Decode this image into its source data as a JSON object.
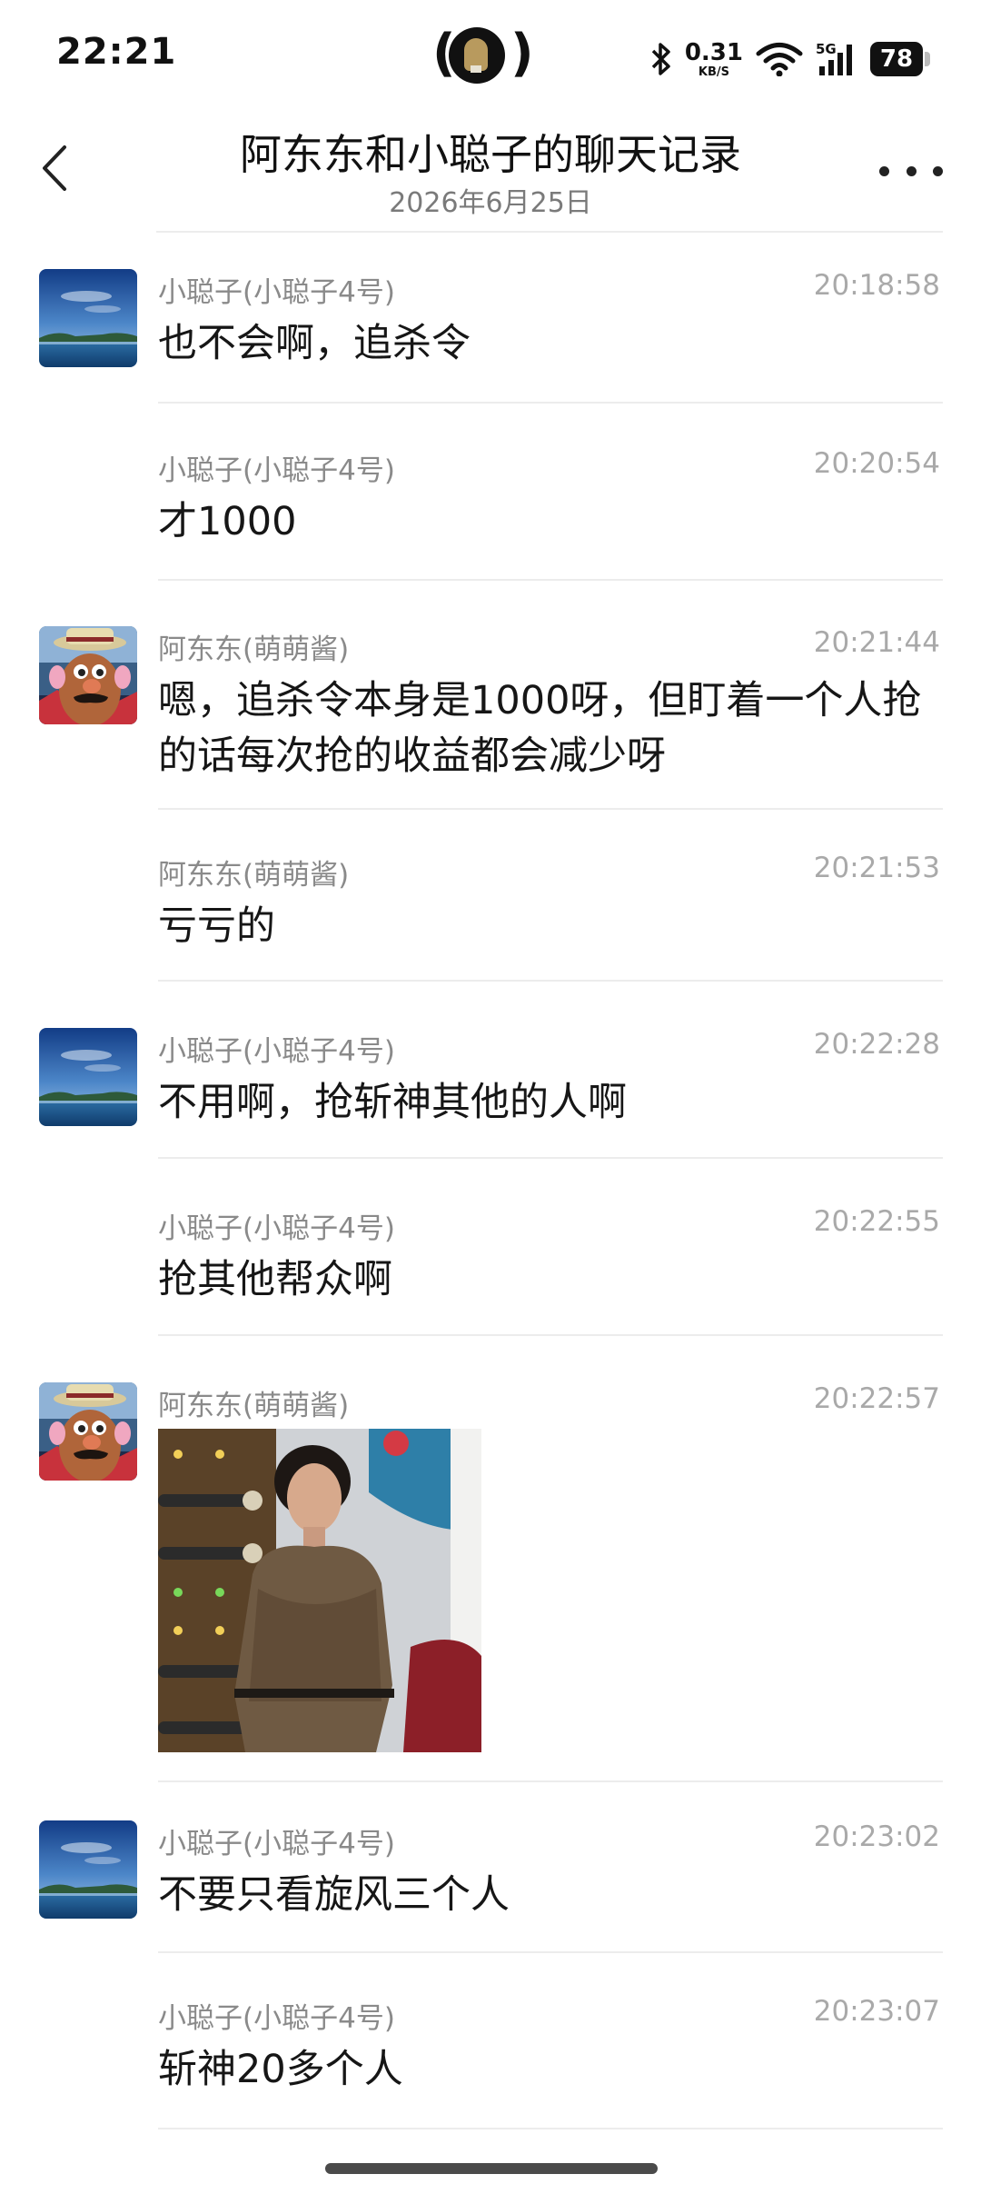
{
  "status_bar": {
    "time": "22:21",
    "net_speed": "0.31",
    "net_unit": "KB/S",
    "network": "5G",
    "battery": "78",
    "icons": [
      "flashlight-icon",
      "bluetooth-icon",
      "wifi-icon",
      "signal-icon",
      "battery-icon"
    ]
  },
  "header": {
    "title": "阿东东和小聪子的聊天记录",
    "date": "2026年6月25日",
    "back_icon": "chevron-left-icon",
    "more_icon": "more-horizontal-icon"
  },
  "messages": [
    {
      "sender": "小聪子(小聪子4号)",
      "time": "20:18:58",
      "text": "也不会啊，追杀令",
      "avatar": "landscape"
    },
    {
      "sender": "小聪子(小聪子4号)",
      "time": "20:20:54",
      "text": "才1000",
      "avatar": ""
    },
    {
      "sender": "阿东东(萌萌酱)",
      "time": "20:21:44",
      "text": "嗯，追杀令本身是1000呀，但盯着一个人抢的话每次抢的收益都会减少呀",
      "avatar": "potato"
    },
    {
      "sender": "阿东东(萌萌酱)",
      "time": "20:21:53",
      "text": "亏亏的",
      "avatar": ""
    },
    {
      "sender": "小聪子(小聪子4号)",
      "time": "20:22:28",
      "text": "不用啊，抢斩神其他的人啊",
      "avatar": "landscape"
    },
    {
      "sender": "小聪子(小聪子4号)",
      "time": "20:22:55",
      "text": "抢其他帮众啊",
      "avatar": ""
    },
    {
      "sender": "阿东东(萌萌酱)",
      "time": "20:22:57",
      "text": "",
      "image": "sticker-photo",
      "avatar": "potato"
    },
    {
      "sender": "小聪子(小聪子4号)",
      "time": "20:23:02",
      "text": "不要只看旋风三个人",
      "avatar": "landscape"
    },
    {
      "sender": "小聪子(小聪子4号)",
      "time": "20:23:07",
      "text": "斩神20多个人",
      "avatar": ""
    }
  ]
}
